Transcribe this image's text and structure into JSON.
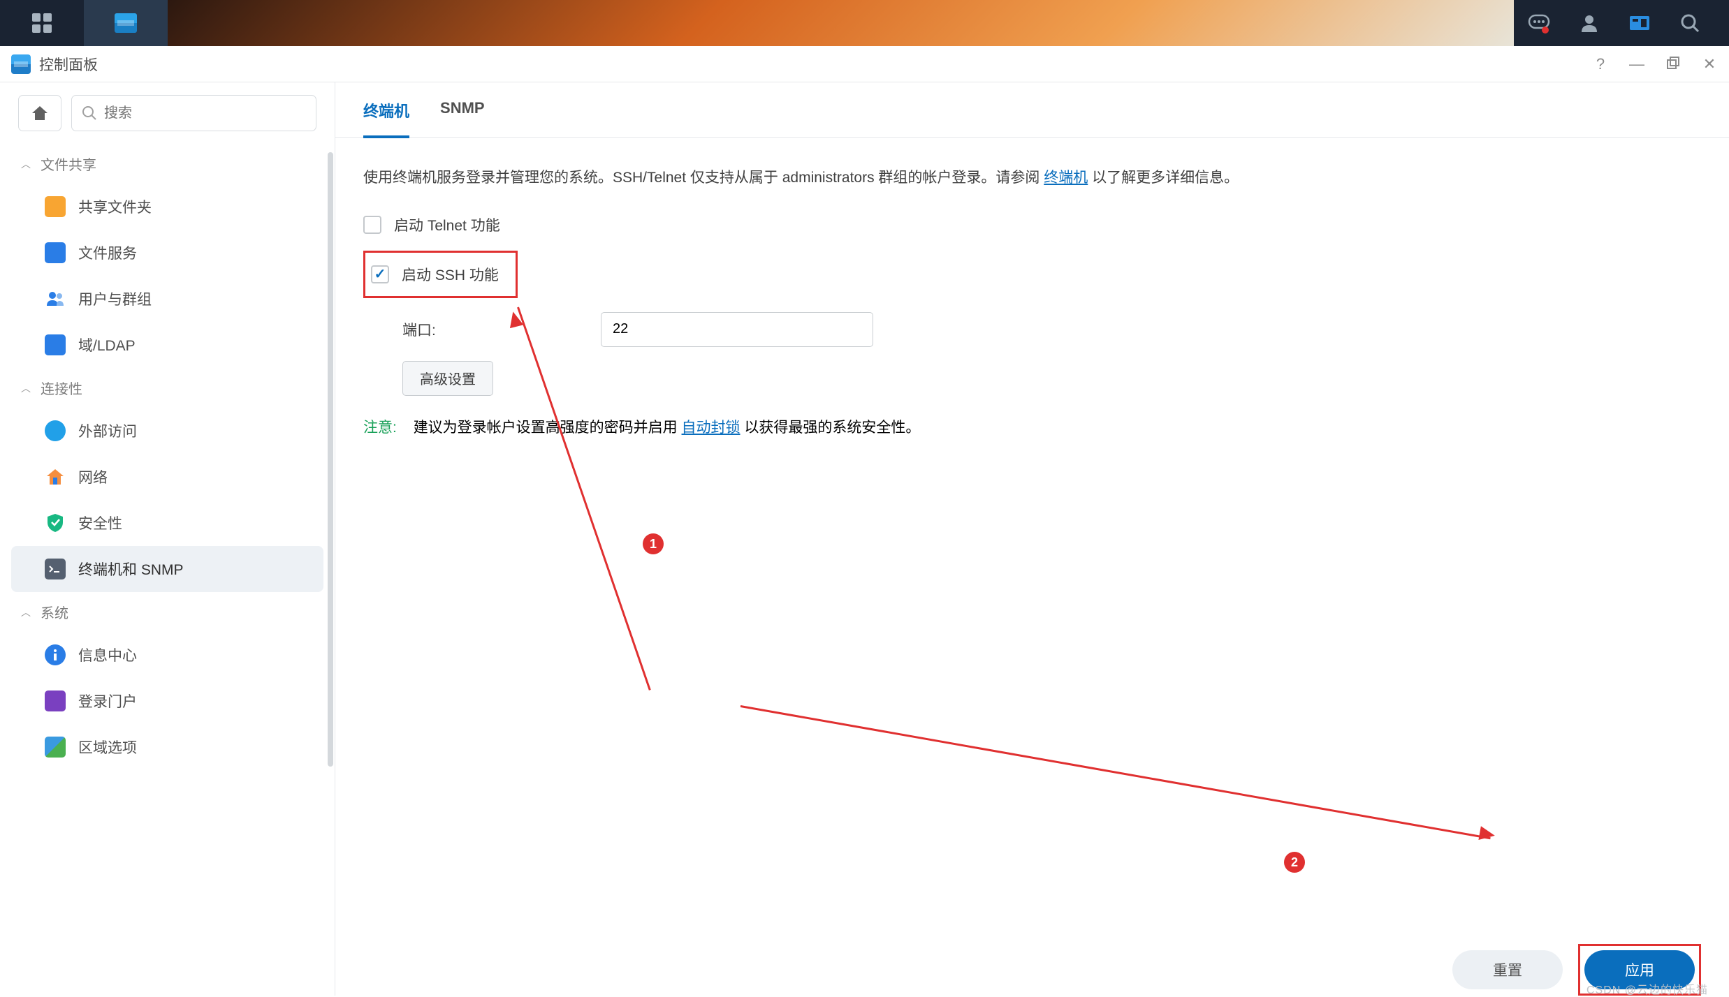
{
  "topbar": {
    "chat": "chat",
    "user": "user",
    "widgets": "widgets",
    "search": "search"
  },
  "window": {
    "title": "控制面板",
    "help": "?",
    "minimize": "—",
    "maximize_icon": "maximize",
    "close": "✕"
  },
  "sidebar": {
    "search_placeholder": "搜索",
    "sections": {
      "file_share": {
        "label": "文件共享",
        "items": [
          "共享文件夹",
          "文件服务",
          "用户与群组",
          "域/LDAP"
        ]
      },
      "connectivity": {
        "label": "连接性",
        "items": [
          "外部访问",
          "网络",
          "安全性",
          "终端机和 SNMP"
        ]
      },
      "system": {
        "label": "系统",
        "items": [
          "信息中心",
          "登录门户",
          "区域选项"
        ]
      }
    }
  },
  "tabs": {
    "terminal": "终端机",
    "snmp": "SNMP"
  },
  "content": {
    "intro_pre": "使用终端机服务登录并管理您的系统。SSH/Telnet 仅支持从属于 administrators 群组的帐户登录。请参阅 ",
    "intro_link": "终端机",
    "intro_post": " 以了解更多详细信息。",
    "telnet_label": "启动 Telnet 功能",
    "ssh_label": "启动 SSH 功能",
    "port_label": "端口:",
    "port_value": "22",
    "advanced_btn": "高级设置",
    "note_label": "注意:",
    "note_pre": "建议为登录帐户设置高强度的密码并启用 ",
    "note_link": "自动封锁",
    "note_post": " 以获得最强的系统安全性。"
  },
  "footer": {
    "reset": "重置",
    "apply": "应用"
  },
  "annotations": {
    "b1": "1",
    "b2": "2"
  },
  "watermark": "CSDN @云边的快乐猫"
}
